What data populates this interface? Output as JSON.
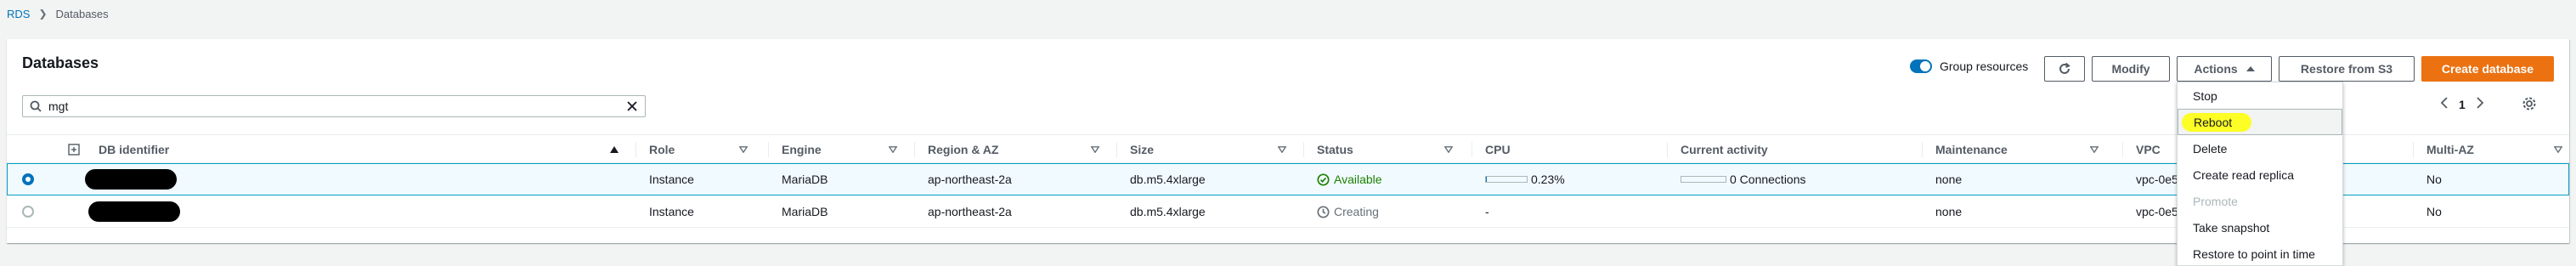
{
  "breadcrumb": {
    "root": "RDS",
    "current": "Databases"
  },
  "panel": {
    "title": "Databases",
    "group_resources_label": "Group resources",
    "buttons": {
      "modify": "Modify",
      "actions": "Actions",
      "restore": "Restore from S3",
      "create": "Create database"
    },
    "search": {
      "value": "mgt"
    },
    "pager": {
      "page": "1"
    }
  },
  "table": {
    "headers": {
      "db_identifier": "DB identifier",
      "role": "Role",
      "engine": "Engine",
      "region": "Region & AZ",
      "size": "Size",
      "status": "Status",
      "cpu": "CPU",
      "activity": "Current activity",
      "maintenance": "Maintenance",
      "vpc": "VPC",
      "multiaz": "Multi-AZ"
    },
    "rows": [
      {
        "role": "Instance",
        "engine": "MariaDB",
        "region": "ap-northeast-2a",
        "size": "db.m5.4xlarge",
        "status": "Available",
        "cpu": "0.23%",
        "cpu_fraction": 0.0023,
        "activity": "0 Connections",
        "maintenance": "none",
        "vpc": "vpc-0e5",
        "multiaz": "No"
      },
      {
        "role": "Instance",
        "engine": "MariaDB",
        "region": "ap-northeast-2a",
        "size": "db.m5.4xlarge",
        "status": "Creating",
        "cpu": "-",
        "activity": "",
        "maintenance": "none",
        "vpc": "vpc-0e5",
        "multiaz": "No"
      }
    ]
  },
  "actions_menu": {
    "items": [
      "Stop",
      "Reboot",
      "Delete",
      "Create read replica",
      "Promote",
      "Take snapshot",
      "Restore to point in time"
    ]
  },
  "colors": {
    "accent": "#0073bb",
    "primary_button": "#ec7211",
    "available": "#1d8102",
    "highlight": "#ffff00"
  }
}
